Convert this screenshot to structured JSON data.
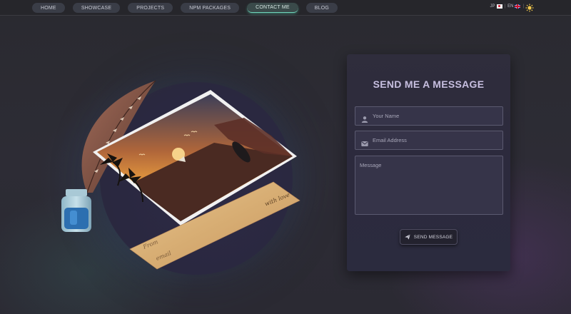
{
  "nav": {
    "items": [
      {
        "label": "HOME"
      },
      {
        "label": "SHOWCASE"
      },
      {
        "label": "PROJECTS"
      },
      {
        "label": "NPM PACKAGES"
      },
      {
        "label": "CONTACT ME",
        "active": true
      },
      {
        "label": "BLOG"
      }
    ],
    "languages": [
      {
        "code": "JP",
        "flag": "japan-flag-icon"
      },
      {
        "code": "EN",
        "flag": "uk-flag-icon"
      }
    ],
    "theme_icon": "sun-icon"
  },
  "illustration": {
    "envelope_text": [
      "From",
      "email"
    ],
    "envelope_signature": "with love",
    "icons": [
      "quill-feather-icon",
      "inkwell-icon",
      "postcard-icon",
      "envelope-icon"
    ]
  },
  "form": {
    "title": "SEND ME A MESSAGE",
    "name_placeholder": "Your Name",
    "email_placeholder": "Email Address",
    "message_placeholder": "Message",
    "submit_label": "SEND MESSAGE",
    "icons": {
      "name": "user-icon",
      "email": "mail-icon",
      "submit": "paper-plane-icon"
    }
  },
  "colors": {
    "accent": "#6fd6bc",
    "title": "#c7bfe0",
    "background": "#2b2a33"
  }
}
